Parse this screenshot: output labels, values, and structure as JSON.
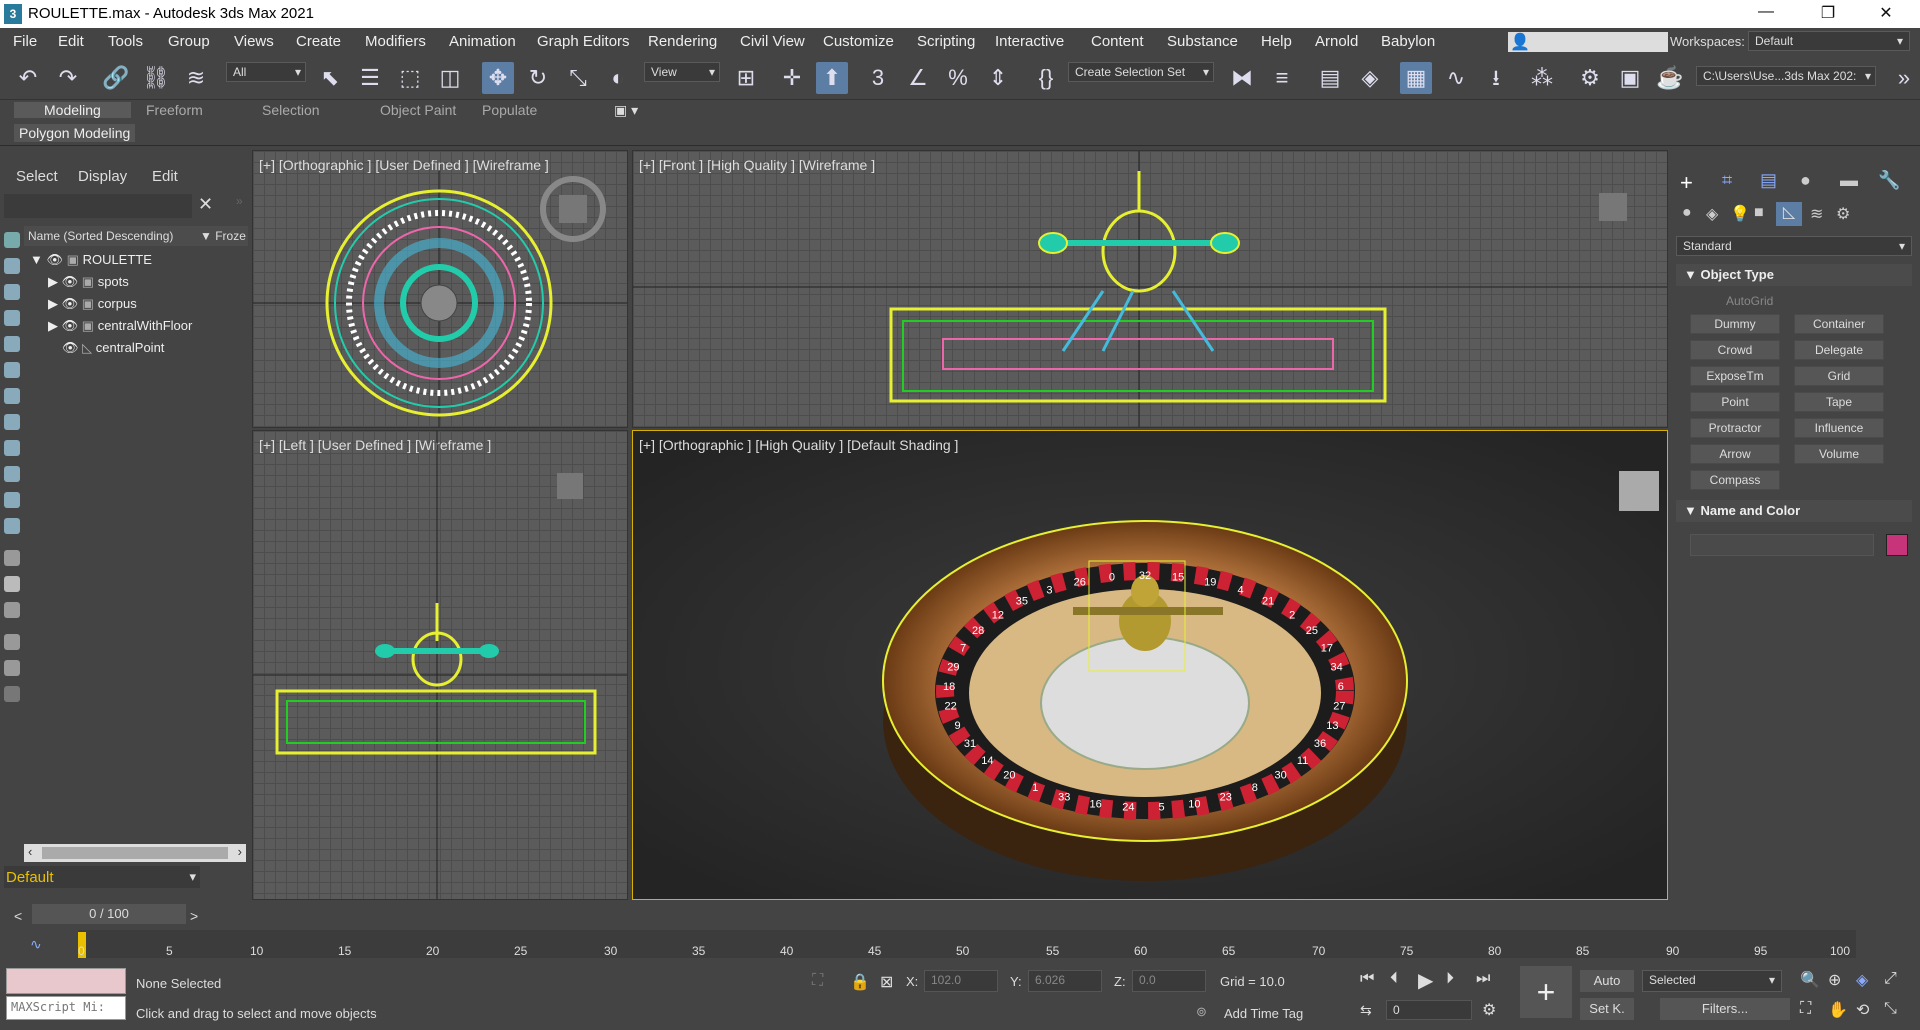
{
  "window": {
    "title": "ROULETTE.max - Autodesk 3ds Max 2021",
    "app_icon": "3",
    "controls": [
      "—",
      "❐",
      "✕"
    ]
  },
  "menu": {
    "items": [
      "File",
      "Edit",
      "Tools",
      "Group",
      "Views",
      "Create",
      "Modifiers",
      "Animation",
      "Graph Editors",
      "Rendering",
      "Civil View",
      "Customize",
      "Scripting",
      "Interactive",
      "Content",
      "Substance",
      "Help",
      "Arnold",
      "Babylon"
    ],
    "workspaces_label": "Workspaces:",
    "workspace_value": "Default"
  },
  "toolbar": {
    "filter_value": "All",
    "view_value": "View",
    "selection_set": "Create Selection Set",
    "path": "C:\\Users\\Use...3ds Max 202:"
  },
  "ribbon": {
    "tabs": [
      "Modeling",
      "Freeform",
      "Selection",
      "Object Paint",
      "Populate"
    ],
    "sub_label": "Polygon Modeling"
  },
  "scene_explorer": {
    "tabs": [
      "Select",
      "Display",
      "Edit"
    ],
    "column_name": "Name (Sorted Descending)",
    "column_frozen": "▼ Froze",
    "items": [
      "ROULETTE",
      "spots",
      "corpus",
      "centralWithFloor",
      "centralPoint"
    ],
    "layer": "Default"
  },
  "viewports": {
    "top_left": "[+] [Orthographic ] [User Defined ] [Wireframe ]",
    "top_right": "[+] [Front ] [High Quality ] [Wireframe ]",
    "bottom_left": "[+] [Left ] [User Defined ] [Wireframe ]",
    "bottom_right": "[+] [Orthographic ] [High Quality ] [Default Shading ]"
  },
  "wheel": {
    "numbers": [
      "32",
      "15",
      "19",
      "4",
      "21",
      "2",
      "25",
      "17",
      "34",
      "6",
      "27",
      "13",
      "36",
      "11",
      "30",
      "8",
      "23",
      "10",
      "5",
      "24",
      "16",
      "33",
      "1",
      "20",
      "14",
      "31",
      "9",
      "22",
      "18",
      "29",
      "7",
      "28",
      "12",
      "35",
      "3",
      "26",
      "0"
    ]
  },
  "command_panel": {
    "category": "Standard",
    "object_type_title": "Object Type",
    "autogrid": "AutoGrid",
    "buttons": [
      "Dummy",
      "Container",
      "Crowd",
      "Delegate",
      "ExposeTm",
      "Grid",
      "Point",
      "Tape",
      "Protractor",
      "Influence",
      "Arrow",
      "Volume",
      "Compass"
    ],
    "name_color_title": "Name and Color",
    "color": "#c8347a"
  },
  "timeline": {
    "frame": "0 / 100",
    "ticks": [
      "0",
      "5",
      "10",
      "15",
      "20",
      "25",
      "30",
      "35",
      "40",
      "45",
      "50",
      "55",
      "60",
      "65",
      "70",
      "75",
      "80",
      "85",
      "90",
      "95",
      "100"
    ]
  },
  "status": {
    "maxscript": "MAXScript Mi:",
    "selection": "None Selected",
    "prompt": "Click and drag to select and move objects",
    "x_label": "X:",
    "x": "102.0",
    "y_label": "Y:",
    "y": "6.026",
    "z_label": "Z:",
    "z": "0.0",
    "grid": "Grid = 10.0",
    "add_time_tag": "Add Time Tag",
    "auto": "Auto",
    "set_key": "Set K.",
    "key_mode": "Selected",
    "filters": "Filters...",
    "frame": "0"
  }
}
